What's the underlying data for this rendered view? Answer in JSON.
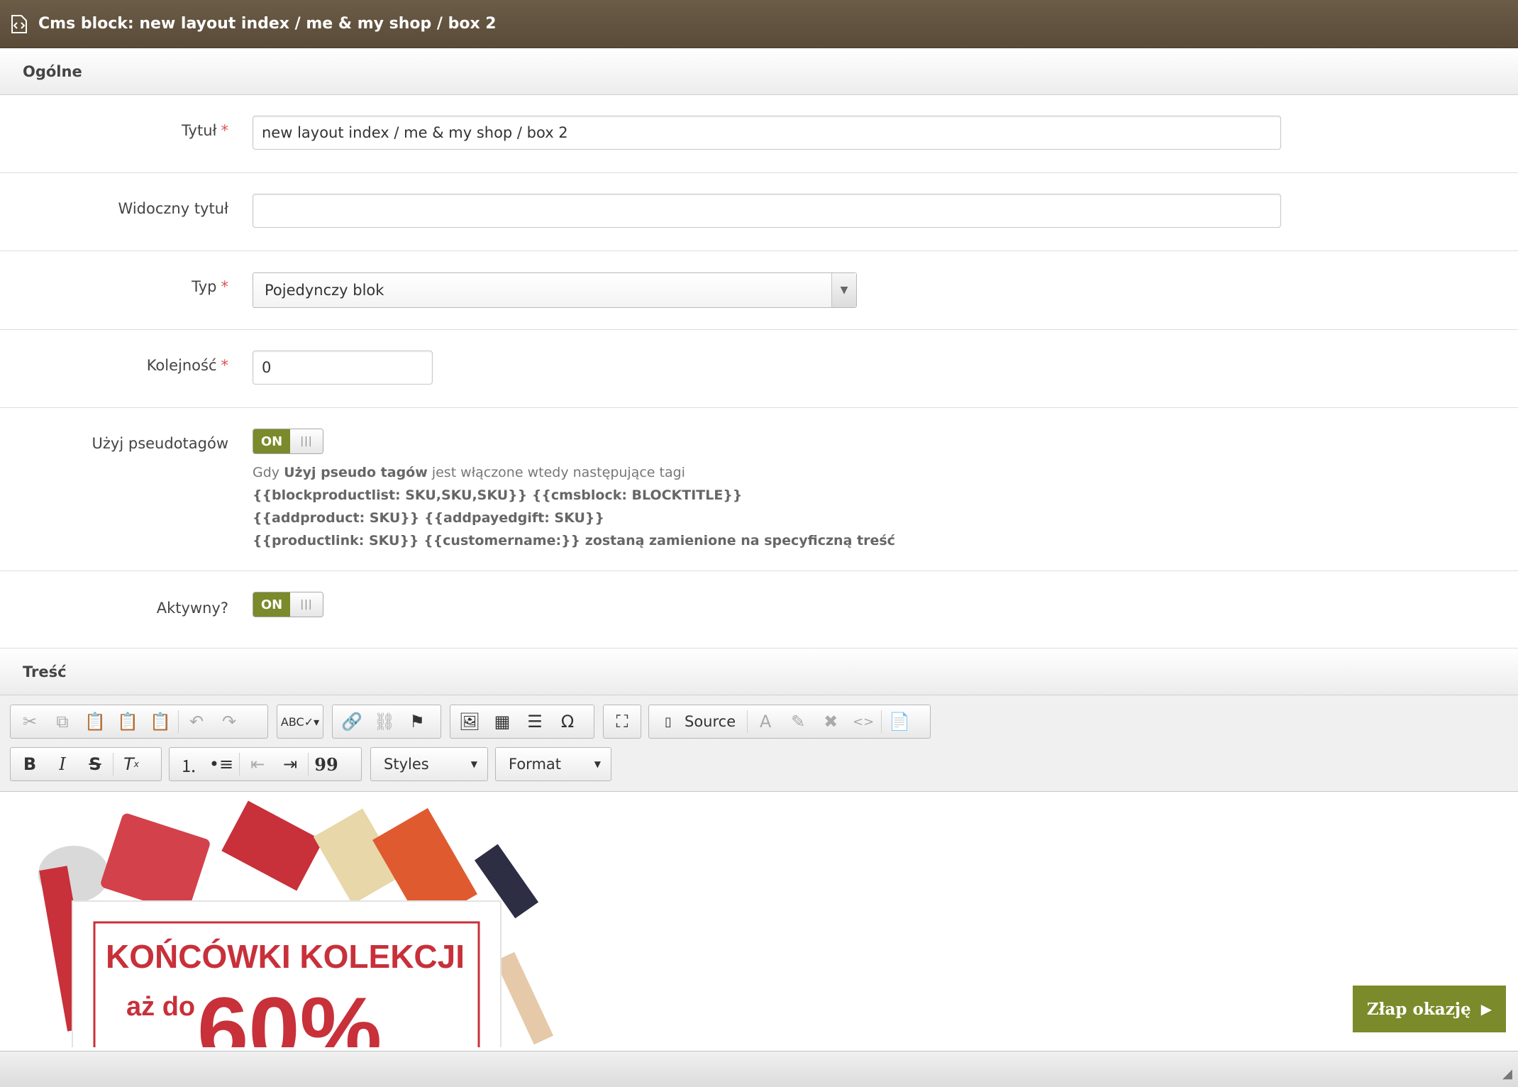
{
  "window": {
    "title": "Cms block: new layout index / me & my shop / box 2"
  },
  "sections": {
    "general": "Ogólne",
    "content": "Treść"
  },
  "form": {
    "title": {
      "label": "Tytuł",
      "required": "*",
      "value": "new layout index / me & my shop / box 2"
    },
    "visible_title": {
      "label": "Widoczny tytuł",
      "value": ""
    },
    "type": {
      "label": "Typ",
      "required": "*",
      "value": "Pojedynczy blok"
    },
    "order": {
      "label": "Kolejność",
      "required": "*",
      "value": "0"
    },
    "pseudotags": {
      "label": "Użyj pseudotagów",
      "toggle": "ON",
      "help_prefix": "Gdy ",
      "help_bold": "Użyj pseudo tagów",
      "help_suffix": " jest włączone wtedy następujące tagi",
      "help_line2": "{{blockproductlist: SKU,SKU,SKU}} {{cmsblock: BLOCKTITLE}}",
      "help_line3": "{{addproduct: SKU}} {{addpayedgift: SKU}}",
      "help_line4": "{{productlink: SKU}} {{customername:}} zostaną zamienione na specyficzną treść"
    },
    "active": {
      "label": "Aktywny?",
      "toggle": "ON"
    }
  },
  "editor": {
    "source_label": "Source",
    "styles_label": "Styles",
    "format_label": "Format",
    "banner": {
      "headline": "KOŃCÓWKI KOLEKCJI",
      "sub": "aż do",
      "percent": "60%",
      "cta": "Złap okazję"
    }
  },
  "colors": {
    "header_bg": "#5f503c",
    "accent": "#7b8a2a",
    "banner_red": "#c8303a"
  }
}
